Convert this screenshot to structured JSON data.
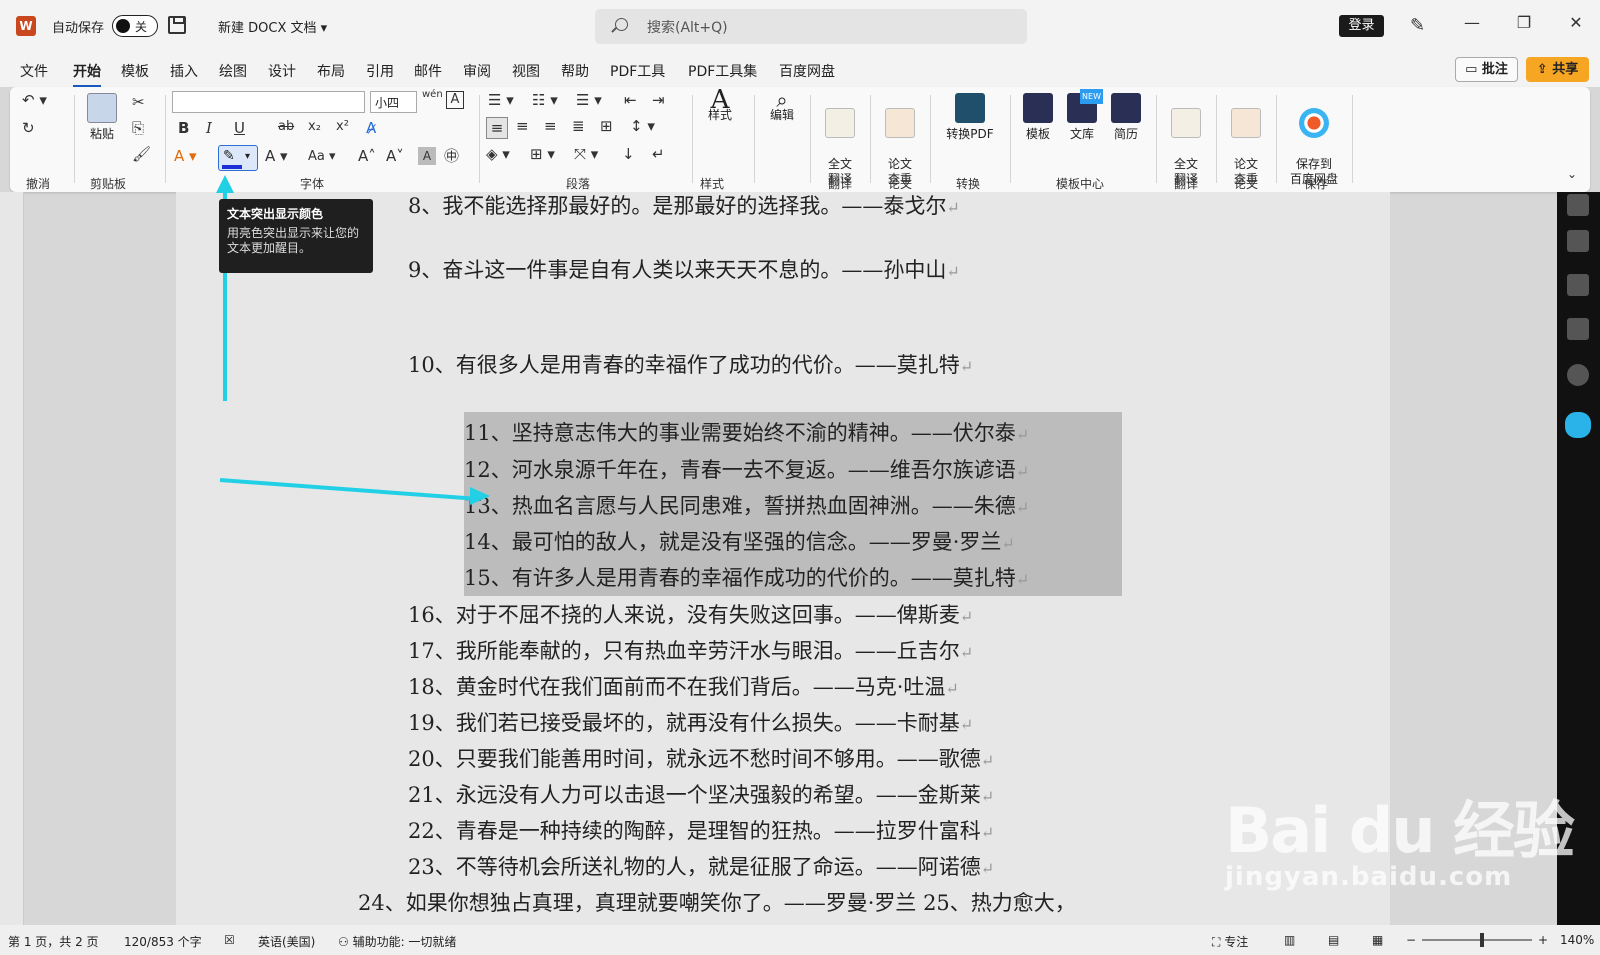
{
  "titlebar": {
    "app_icon": "W",
    "autosave_label": "自动保存",
    "autosave_state": "关",
    "doc_title": "新建 DOCX 文档 ▾",
    "search_placeholder": "搜索(Alt+Q)",
    "login_label": "登录",
    "min": "—",
    "restore": "❐",
    "close": "✕"
  },
  "menu": {
    "items": [
      "文件",
      "开始",
      "模板",
      "插入",
      "绘图",
      "设计",
      "布局",
      "引用",
      "邮件",
      "审阅",
      "视图",
      "帮助",
      "PDF工具",
      "PDF工具集",
      "百度网盘"
    ],
    "active": "开始",
    "review_btn": "批注",
    "share_btn": "共享"
  },
  "ribbon": {
    "groups": [
      "撤消",
      "剪贴板",
      "字体",
      "段落",
      "样式",
      "翻译",
      "论文",
      "转换",
      "模板中心",
      "翻译",
      "论文",
      "保存"
    ],
    "font_size": "小四",
    "paste": "粘贴",
    "style": "样式",
    "edit": "编辑",
    "full_translate": "全文\n翻译",
    "paper_check": "论文\n查重",
    "to_pdf": "转换PDF",
    "template": "模板",
    "library": "文库",
    "resume": "简历",
    "new_badge": "NEW",
    "save_baidu": "保存到\n百度网盘",
    "bold": "B",
    "italic": "I",
    "underline": "U",
    "strike": "ab",
    "sub": "x₂",
    "sup": "x²",
    "wen": "wén",
    "A": "A",
    "Aa": "Aa"
  },
  "tooltip": {
    "title": "文本突出显示颜色",
    "body": "用亮色突出显示来让您的文本更加醒目。"
  },
  "document": {
    "lines": [
      "8、我不能选择那最好的。是那最好的选择我。——泰戈尔",
      "9、奋斗这一件事是自有人类以来天天不息的。——孙中山",
      "10、有很多人是用青春的幸福作了成功的代价。——莫扎特",
      "11、坚持意志伟大的事业需要始终不渝的精神。——伏尔泰",
      "12、河水泉源千年在，青春一去不复返。——维吾尔族谚语",
      "13、热血名言愿与人民同患难，誓拼热血固神洲。——朱德",
      "14、最可怕的敌人，就是没有坚强的信念。——罗曼·罗兰",
      "15、有许多人是用青春的幸福作成功的代价的。——莫扎特",
      "16、对于不屈不挠的人来说，没有失败这回事。——俾斯麦",
      "17、我所能奉献的，只有热血辛劳汗水与眼泪。——丘吉尔",
      "18、黄金时代在我们面前而不在我们背后。——马克·吐温",
      "19、我们若已接受最坏的，就再没有什么损失。——卡耐基",
      "20、只要我们能善用时间，就永远不愁时间不够用。——歌德",
      "21、永远没有人力可以击退一个坚决强毅的希望。——金斯莱",
      "22、青春是一种持续的陶醉，是理智的狂热。——拉罗什富科",
      "23、不等待机会所送礼物的人，就是征服了命运。——阿诺德",
      "24、如果你想独占真理，真理就要嘲笑你了。——罗曼·罗兰 25、热力愈大，"
    ],
    "return_mark": "↵"
  },
  "status": {
    "page": "第 1 页，共 2 页",
    "words": "120/853 个字",
    "lang": "英语(美国)",
    "accessibility": "辅助功能: 一切就绪",
    "focus": "专注",
    "zoom": "140%"
  },
  "watermark": {
    "line1": "Bai du 经验",
    "line2": "jingyan.baidu.com"
  },
  "colors": {
    "accent": "#185abd",
    "share": "#f6a623",
    "arrow": "#22d0e6",
    "selection": "#bcbcbc"
  }
}
